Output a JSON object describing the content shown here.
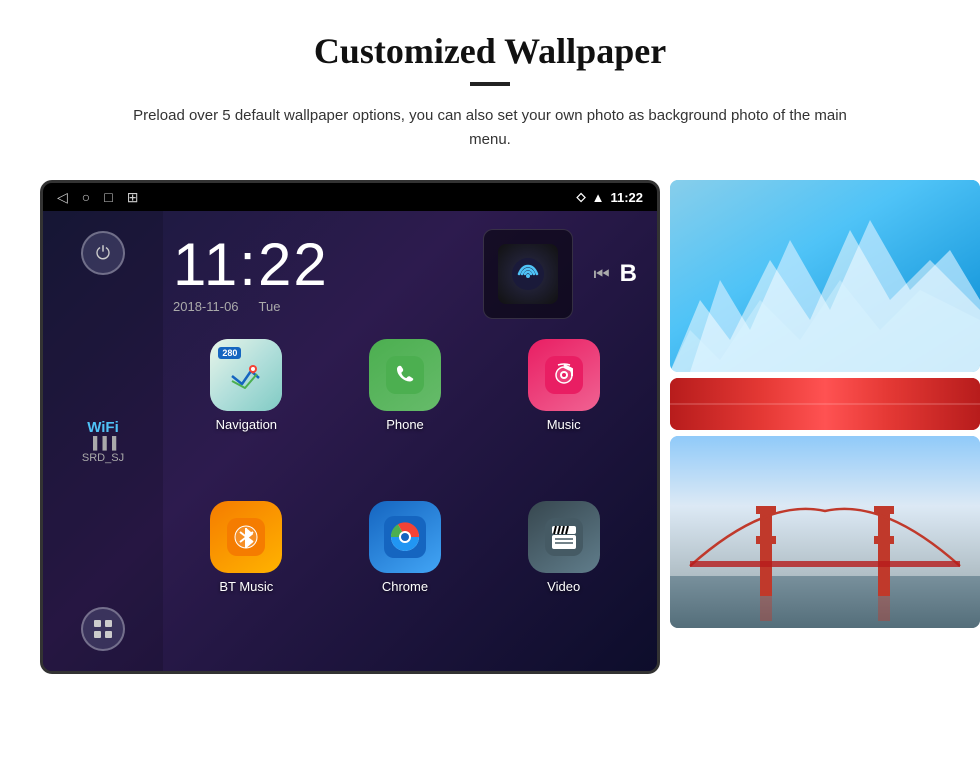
{
  "page": {
    "title": "Customized Wallpaper",
    "description": "Preload over 5 default wallpaper options, you can also set your own photo as background photo of the main menu."
  },
  "device": {
    "status_bar": {
      "time": "11:22",
      "nav_icons": [
        "◁",
        "○",
        "□",
        "⊞"
      ],
      "right_icons": [
        "location",
        "wifi",
        "signal"
      ]
    },
    "clock": {
      "time": "11:22",
      "date": "2018-11-06",
      "day": "Tue"
    },
    "wifi": {
      "label": "WiFi",
      "ssid": "SRD_SJ"
    },
    "apps": [
      {
        "id": "navigation",
        "label": "Navigation",
        "icon_type": "navigation"
      },
      {
        "id": "phone",
        "label": "Phone",
        "icon_type": "phone"
      },
      {
        "id": "music",
        "label": "Music",
        "icon_type": "music"
      },
      {
        "id": "bt-music",
        "label": "BT Music",
        "icon_type": "bt-music"
      },
      {
        "id": "chrome",
        "label": "Chrome",
        "icon_type": "chrome"
      },
      {
        "id": "video",
        "label": "Video",
        "icon_type": "video"
      }
    ],
    "media": {
      "icon": "wifi-signal"
    }
  },
  "wallpapers": {
    "top_label": "Ice Cave",
    "middle_label": "",
    "bottom_label": "Golden Gate Bridge"
  }
}
